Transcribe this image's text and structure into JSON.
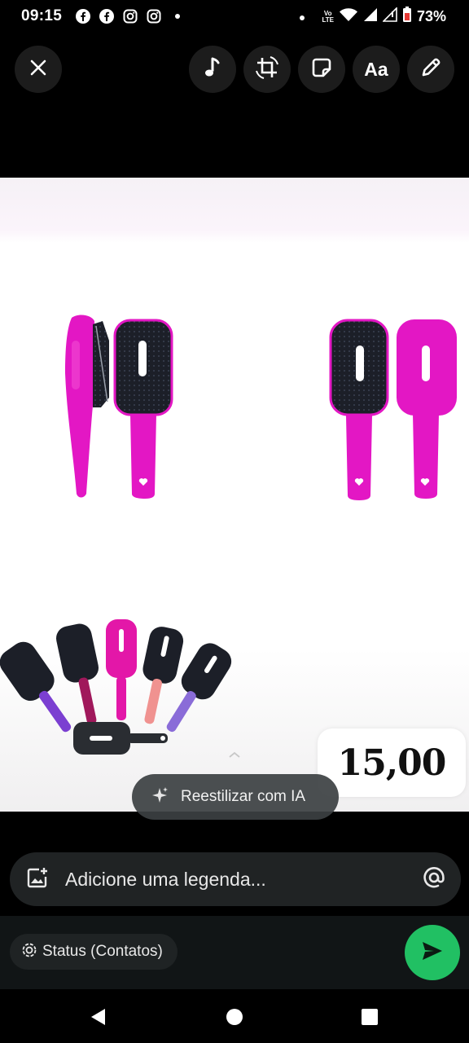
{
  "status_bar": {
    "time": "09:15",
    "notification_icons": [
      "facebook-icon",
      "facebook-icon",
      "instagram-icon",
      "instagram-icon",
      "dot-icon"
    ],
    "network_label_top": "Vo",
    "network_label_bottom": "LTE",
    "battery": "73%"
  },
  "toolbar": {
    "close_icon": "close-icon",
    "music_icon": "music-note-icon",
    "crop_icon": "crop-rotate-icon",
    "sticker_icon": "sticker-icon",
    "text_label": "Aa",
    "draw_icon": "pencil-icon"
  },
  "media": {
    "price": "15,00",
    "restyle_label": "Reestilizar com IA"
  },
  "caption": {
    "placeholder": "Adicione uma legenda...",
    "mention_icon": "at-icon",
    "add_media_icon": "add-image-icon"
  },
  "bottom_bar": {
    "audience_label": "Status (Contatos)",
    "send_icon": "send-icon"
  },
  "colors": {
    "send_green": "#21c063",
    "brush_magenta": "#e317c4",
    "brush_black": "#1c1f28"
  }
}
